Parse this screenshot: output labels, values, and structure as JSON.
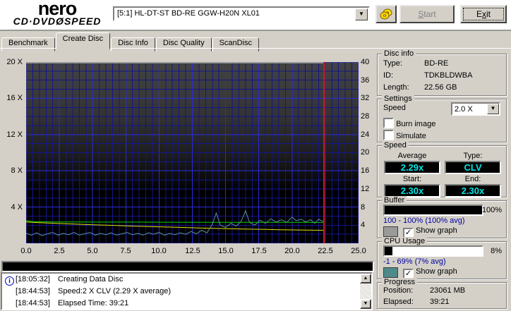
{
  "app": {
    "logo_line1": "nero",
    "logo_line2_left": "CD·DVD",
    "logo_line2_disc": "Ø",
    "logo_line2_right": "SPEED",
    "drive_select": "[5:1]  HL-DT-ST BD-RE  GGW-H20N XL01",
    "start_btn": {
      "u": "S",
      "post": "tart"
    },
    "exit_btn": {
      "pre": "E",
      "u": "x",
      "post": "it"
    }
  },
  "tabs": [
    "Benchmark",
    "Create Disc",
    "Disc Info",
    "Disc Quality",
    "ScanDisc"
  ],
  "chart_data": {
    "type": "line",
    "title": "Create Disc write graph",
    "x_range": [
      0,
      25
    ],
    "y_left_range": [
      0,
      20
    ],
    "y_right_range": [
      0,
      40
    ],
    "x_ticks": [
      "0.0",
      "2.5",
      "5.0",
      "7.5",
      "10.0",
      "12.5",
      "15.0",
      "17.5",
      "20.0",
      "22.5",
      "25.0"
    ],
    "y_left_ticks": [
      "20 X",
      "16 X",
      "12 X",
      "8 X",
      "4 X"
    ],
    "y_right_ticks": [
      "40",
      "36",
      "32",
      "28",
      "24",
      "20",
      "16",
      "12",
      "8",
      "4"
    ],
    "grid": {
      "minor_color": "#15158c",
      "major_color": "#2c2cdc",
      "minor_x": 0.5,
      "major_x": 2.5,
      "minor_y": 1,
      "major_y": 4
    },
    "position_line": {
      "x": 22.4,
      "color": "#dd1010"
    },
    "series": [
      {
        "name": "buffer-level-gray",
        "color": "#9a9a9a",
        "width": 2,
        "points": [
          [
            0,
            19.93
          ],
          [
            22.4,
            19.93
          ]
        ]
      },
      {
        "name": "write-speed-green",
        "color": "#00d400",
        "width": 1,
        "points": [
          [
            0,
            2.5
          ],
          [
            0.5,
            2.4
          ],
          [
            1,
            2.38
          ],
          [
            2,
            2.36
          ],
          [
            4,
            2.35
          ],
          [
            6,
            2.34
          ],
          [
            8,
            2.34
          ],
          [
            10,
            2.33
          ],
          [
            12,
            2.33
          ],
          [
            14,
            2.32
          ],
          [
            16,
            2.32
          ],
          [
            18,
            2.31
          ],
          [
            20,
            2.31
          ],
          [
            22.4,
            2.3
          ]
        ]
      },
      {
        "name": "declining-speed-yellow",
        "color": "#e3e300",
        "width": 1,
        "points": [
          [
            0,
            2.35
          ],
          [
            1,
            2.28
          ],
          [
            2,
            2.22
          ],
          [
            3,
            2.16
          ],
          [
            4,
            2.1
          ],
          [
            5,
            2.05
          ],
          [
            6,
            2.0
          ],
          [
            7,
            1.95
          ],
          [
            8,
            1.9
          ],
          [
            9,
            1.86
          ],
          [
            10,
            1.82
          ],
          [
            11,
            1.78
          ],
          [
            12,
            1.74
          ],
          [
            13,
            1.7
          ],
          [
            14,
            1.66
          ],
          [
            15,
            1.62
          ],
          [
            16,
            1.59
          ],
          [
            17,
            1.56
          ],
          [
            18,
            1.53
          ],
          [
            19,
            1.5
          ],
          [
            20,
            1.48
          ],
          [
            21,
            1.46
          ],
          [
            22.4,
            1.44
          ]
        ]
      },
      {
        "name": "cpu-usage-teal",
        "color": "#5a9292",
        "width": 1,
        "points": [
          [
            0,
            1.1
          ],
          [
            0.4,
            0.9
          ],
          [
            0.8,
            1.15
          ],
          [
            1.2,
            0.85
          ],
          [
            1.6,
            1.05
          ],
          [
            2,
            1.2
          ],
          [
            2.4,
            0.9
          ],
          [
            2.8,
            1.1
          ],
          [
            3.2,
            0.95
          ],
          [
            3.6,
            1.2
          ],
          [
            4,
            0.9
          ],
          [
            4.4,
            1.05
          ],
          [
            4.8,
            1.2
          ],
          [
            5.2,
            0.9
          ],
          [
            5.6,
            1.1
          ],
          [
            6,
            0.95
          ],
          [
            6.4,
            1.15
          ],
          [
            6.8,
            0.9
          ],
          [
            7.2,
            1.05
          ],
          [
            7.6,
            1.2
          ],
          [
            8,
            0.95
          ],
          [
            8.4,
            1.1
          ],
          [
            8.8,
            0.9
          ],
          [
            9.2,
            1.15
          ],
          [
            9.6,
            1.0
          ],
          [
            10,
            1.2
          ],
          [
            10.4,
            0.9
          ],
          [
            10.8,
            1.1
          ],
          [
            11.2,
            0.95
          ],
          [
            11.6,
            1.15
          ],
          [
            12,
            1.0
          ],
          [
            12.4,
            1.3
          ],
          [
            12.8,
            1.05
          ],
          [
            13.2,
            1.45
          ],
          [
            13.6,
            1.15
          ],
          [
            14,
            2.1
          ],
          [
            14.3,
            3.35
          ],
          [
            14.6,
            2.0
          ],
          [
            15,
            1.75
          ],
          [
            15.4,
            2.2
          ],
          [
            15.8,
            1.9
          ],
          [
            16.2,
            2.5
          ],
          [
            16.5,
            3.6
          ],
          [
            16.8,
            2.3
          ],
          [
            17.2,
            2.0
          ],
          [
            17.6,
            2.55
          ],
          [
            18,
            2.2
          ],
          [
            18.4,
            2.7
          ],
          [
            18.8,
            2.35
          ],
          [
            19.2,
            2.6
          ],
          [
            19.6,
            2.3
          ],
          [
            20,
            2.9
          ],
          [
            20.3,
            2.5
          ],
          [
            20.7,
            2.65
          ],
          [
            21,
            2.35
          ],
          [
            21.4,
            2.6
          ],
          [
            21.7,
            2.2
          ],
          [
            22,
            2.65
          ],
          [
            22.4,
            2.35
          ]
        ]
      }
    ]
  },
  "disc_info": {
    "title": "Disc info",
    "type_label": "Type:",
    "type": "BD-RE",
    "id_label": "ID:",
    "id": "TDKBLDWBA",
    "length_label": "Length:",
    "length": "22.56 GB"
  },
  "settings": {
    "title": "Settings",
    "speed_label": "Speed",
    "speed_value": "2.0 X",
    "burn_image_label": "Burn image",
    "burn_image_checked": false,
    "simulate_label": "Simulate",
    "simulate_checked": false
  },
  "speed": {
    "title": "Speed",
    "average_label": "Average",
    "average": "2.29x",
    "type_label": "Type:",
    "type": "CLV",
    "start_label": "Start:",
    "start": "2.30x",
    "end_label": "End:",
    "end": "2.30x"
  },
  "buffer": {
    "title": "Buffer",
    "percent": "100%",
    "bar_percent": 100,
    "range": "100 - 100% (100% avg)",
    "swatch_color": "#9a9a9a",
    "show_graph_label": "Show graph",
    "show_graph_checked": true
  },
  "cpu": {
    "title": "CPU Usage",
    "percent": "8%",
    "bar_percent": 8,
    "range": "-1 - 69% (7% avg)",
    "swatch_color": "#4e8a8a",
    "show_graph_label": "Show graph",
    "show_graph_checked": true
  },
  "progress": {
    "title": "Progress",
    "position_label": "Position:",
    "position": "23061 MB",
    "elapsed_label": "Elapsed:",
    "elapsed": "39:21",
    "burn_bar_percent": 100
  },
  "log": {
    "lines": [
      {
        "time": "[18:05:32]",
        "text": "Creating Data Disc"
      },
      {
        "time": "[18:44:53]",
        "text": "Speed:2 X CLV (2.29 X average)"
      },
      {
        "time": "[18:44:53]",
        "text": "Elapsed Time: 39:21"
      }
    ]
  }
}
